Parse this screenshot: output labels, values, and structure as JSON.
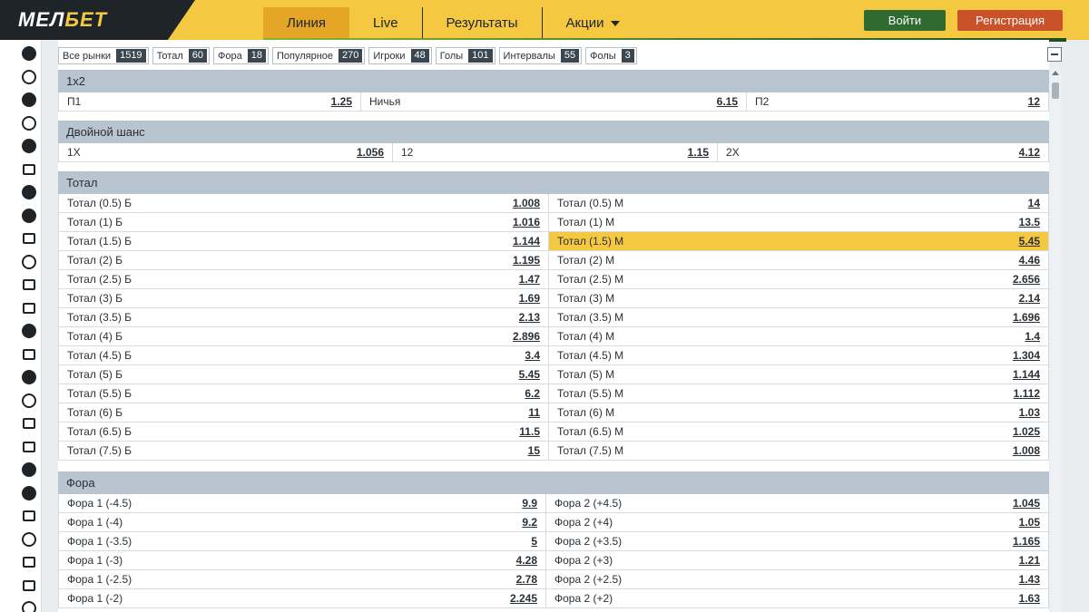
{
  "header": {
    "logo_main": "МЕЛ",
    "logo_accent": "БЕТ",
    "nav": [
      {
        "label": "Линия",
        "active": true
      },
      {
        "label": "Live",
        "active": false
      },
      {
        "label": "Результаты",
        "active": false
      },
      {
        "label": "Акции",
        "active": false
      }
    ],
    "login_label": "Войти",
    "register_label": "Регистрация"
  },
  "sidebar_icons": [
    "tennis-icon",
    "basketball-icon",
    "hockey-puck-icon",
    "volleyball-icon",
    "table-tennis-icon",
    "golf-icon",
    "pacman-icon",
    "rugby-ball-icon",
    "badminton-icon",
    "baseball-icon",
    "billiards-icon",
    "horse-racing-icon",
    "motorsport-icon",
    "stadium-icon",
    "american-football-icon",
    "australian-football-icon",
    "chess-icon",
    "boxing-icon",
    "snooker-ball-icon",
    "helmet-icon",
    "field-hockey-icon",
    "wheel-icon",
    "darts-board-icon",
    "tv-icon",
    "target-icon"
  ],
  "filters": [
    {
      "label": "Все рынки",
      "count": "1519"
    },
    {
      "label": "Тотал",
      "count": "60"
    },
    {
      "label": "Фора",
      "count": "18"
    },
    {
      "label": "Популярное",
      "count": "270"
    },
    {
      "label": "Игроки",
      "count": "48"
    },
    {
      "label": "Голы",
      "count": "101"
    },
    {
      "label": "Интервалы",
      "count": "55"
    },
    {
      "label": "Фолы",
      "count": "3"
    }
  ],
  "market_1x2": {
    "title": "1x2",
    "cells": [
      {
        "label": "П1",
        "odd": "1.25"
      },
      {
        "label": "Ничья",
        "odd": "6.15"
      },
      {
        "label": "П2",
        "odd": "12"
      }
    ]
  },
  "market_double": {
    "title": "Двойной шанс",
    "cells": [
      {
        "label": "1X",
        "odd": "1.056"
      },
      {
        "label": "12",
        "odd": "1.15"
      },
      {
        "label": "2X",
        "odd": "4.12"
      }
    ]
  },
  "market_total": {
    "title": "Тотал",
    "rows": [
      [
        {
          "label": "Тотал (0.5) Б",
          "odd": "1.008"
        },
        {
          "label": "Тотал (0.5) М",
          "odd": "14"
        }
      ],
      [
        {
          "label": "Тотал (1) Б",
          "odd": "1.016"
        },
        {
          "label": "Тотал (1) М",
          "odd": "13.5"
        }
      ],
      [
        {
          "label": "Тотал (1.5) Б",
          "odd": "1.144"
        },
        {
          "label": "Тотал (1.5) М",
          "odd": "5.45",
          "highlight": true
        }
      ],
      [
        {
          "label": "Тотал (2) Б",
          "odd": "1.195"
        },
        {
          "label": "Тотал (2) М",
          "odd": "4.46"
        }
      ],
      [
        {
          "label": "Тотал (2.5) Б",
          "odd": "1.47"
        },
        {
          "label": "Тотал (2.5) М",
          "odd": "2.656"
        }
      ],
      [
        {
          "label": "Тотал (3) Б",
          "odd": "1.69"
        },
        {
          "label": "Тотал (3) М",
          "odd": "2.14"
        }
      ],
      [
        {
          "label": "Тотал (3.5) Б",
          "odd": "2.13"
        },
        {
          "label": "Тотал (3.5) М",
          "odd": "1.696"
        }
      ],
      [
        {
          "label": "Тотал (4) Б",
          "odd": "2.896"
        },
        {
          "label": "Тотал (4) М",
          "odd": "1.4"
        }
      ],
      [
        {
          "label": "Тотал (4.5) Б",
          "odd": "3.4"
        },
        {
          "label": "Тотал (4.5) М",
          "odd": "1.304"
        }
      ],
      [
        {
          "label": "Тотал (5) Б",
          "odd": "5.45"
        },
        {
          "label": "Тотал (5) М",
          "odd": "1.144"
        }
      ],
      [
        {
          "label": "Тотал (5.5) Б",
          "odd": "6.2"
        },
        {
          "label": "Тотал (5.5) М",
          "odd": "1.112"
        }
      ],
      [
        {
          "label": "Тотал (6) Б",
          "odd": "11"
        },
        {
          "label": "Тотал (6) М",
          "odd": "1.03"
        }
      ],
      [
        {
          "label": "Тотал (6.5) Б",
          "odd": "11.5"
        },
        {
          "label": "Тотал (6.5) М",
          "odd": "1.025"
        }
      ],
      [
        {
          "label": "Тотал (7.5) Б",
          "odd": "15"
        },
        {
          "label": "Тотал (7.5) М",
          "odd": "1.008"
        }
      ]
    ]
  },
  "market_fora": {
    "title": "Фора",
    "rows": [
      [
        {
          "label": "Фора 1 (-4.5)",
          "odd": "9.9"
        },
        {
          "label": "Фора 2 (+4.5)",
          "odd": "1.045"
        }
      ],
      [
        {
          "label": "Фора 1 (-4)",
          "odd": "9.2"
        },
        {
          "label": "Фора 2 (+4)",
          "odd": "1.05"
        }
      ],
      [
        {
          "label": "Фора 1 (-3.5)",
          "odd": "5"
        },
        {
          "label": "Фора 2 (+3.5)",
          "odd": "1.165"
        }
      ],
      [
        {
          "label": "Фора 1 (-3)",
          "odd": "4.28"
        },
        {
          "label": "Фора 2 (+3)",
          "odd": "1.21"
        }
      ],
      [
        {
          "label": "Фора 1 (-2.5)",
          "odd": "2.78"
        },
        {
          "label": "Фора 2 (+2.5)",
          "odd": "1.43"
        }
      ],
      [
        {
          "label": "Фора 1 (-2)",
          "odd": "2.245"
        },
        {
          "label": "Фора 2 (+2)",
          "odd": "1.63"
        }
      ]
    ]
  },
  "colors": {
    "brand_yellow": "#f5c842",
    "login_green": "#2f6b2f",
    "register_orange": "#c9522a",
    "section_header": "#b8c4cf",
    "highlight": "#f5c842"
  }
}
